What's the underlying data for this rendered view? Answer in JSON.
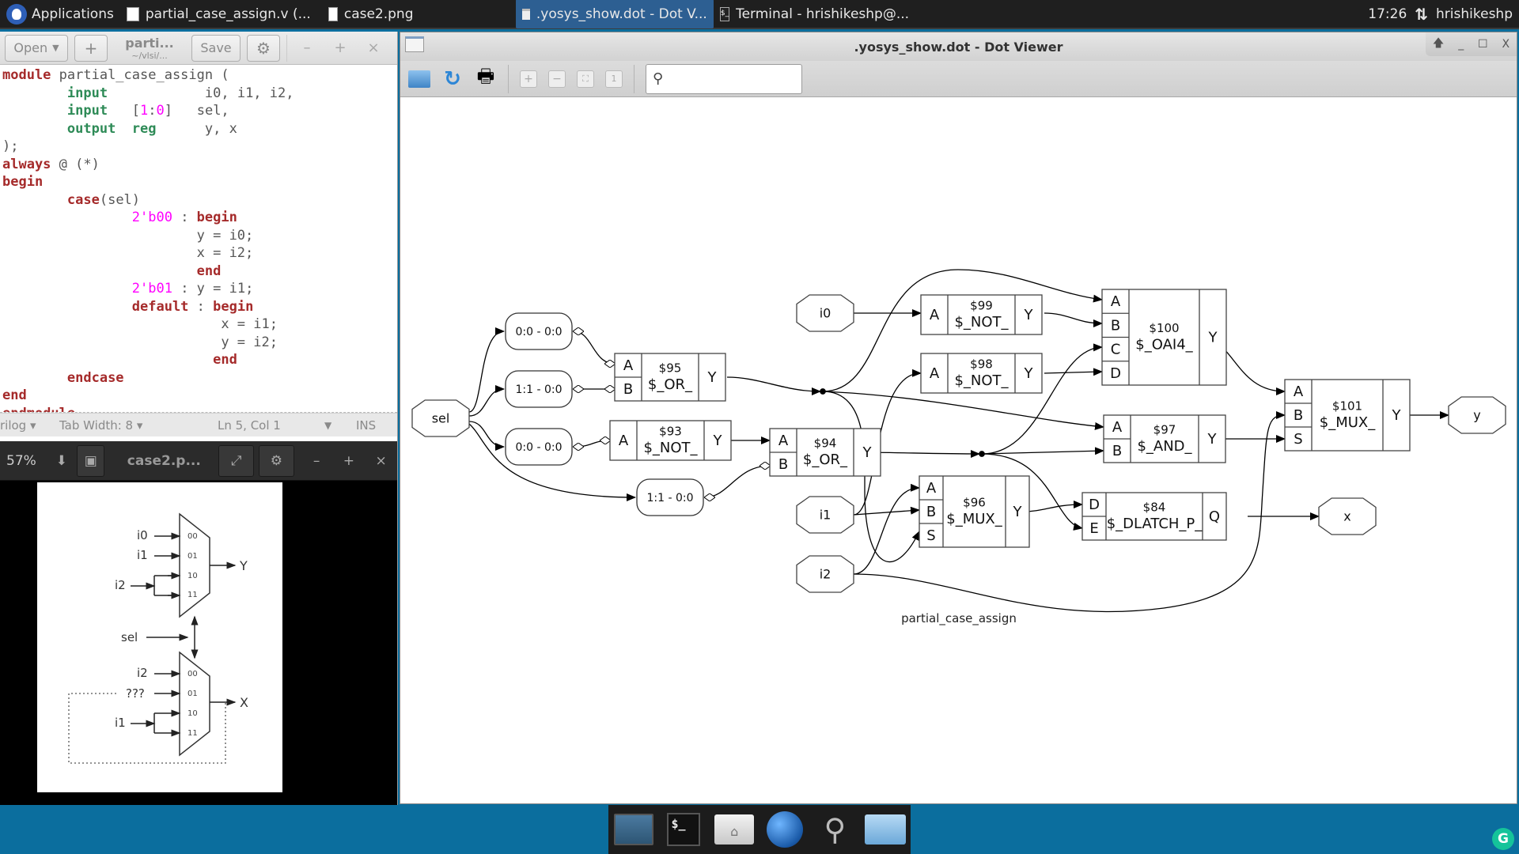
{
  "top_panel": {
    "applications_label": "Applications",
    "tasks": [
      {
        "label": "partial_case_assign.v (...",
        "icon": "text-editor-icon",
        "active": false
      },
      {
        "label": "case2.png",
        "icon": "image-file-icon",
        "active": false
      },
      {
        "label": ".yosys_show.dot - Dot V...",
        "icon": "window-icon",
        "active": true
      },
      {
        "label": "Terminal - hrishikeshp@...",
        "icon": "terminal-icon",
        "active": false
      }
    ],
    "clock": "17:26",
    "network_icon": "network-updown-icon",
    "user": "hrishikeshp"
  },
  "editor": {
    "open_label": "Open",
    "new_tab_label": "+",
    "file_title": "parti...",
    "file_path": "~/vlsi/...",
    "save_label": "Save",
    "code_lines": [
      [
        [
          "kw",
          "module"
        ],
        [
          "p",
          " partial_case_assign ("
        ]
      ],
      [
        [
          "p",
          "        "
        ],
        [
          "ty",
          "input"
        ],
        [
          "p",
          "            i0, i1, i2,"
        ]
      ],
      [
        [
          "p",
          "        "
        ],
        [
          "ty",
          "input"
        ],
        [
          "p",
          "   ["
        ],
        [
          "num",
          "1"
        ],
        [
          "p",
          ":"
        ],
        [
          "num",
          "0"
        ],
        [
          "p",
          "]   sel,"
        ]
      ],
      [
        [
          "p",
          "        "
        ],
        [
          "ty",
          "output"
        ],
        [
          "p",
          "  "
        ],
        [
          "ty",
          "reg"
        ],
        [
          "p",
          "      y, x"
        ]
      ],
      [
        [
          "p",
          ");"
        ]
      ],
      [
        [
          "kw",
          "always"
        ],
        [
          "p",
          " @ (*)"
        ]
      ],
      [
        [
          "kw",
          "begin"
        ]
      ],
      [
        [
          "p",
          "        "
        ],
        [
          "kw",
          "case"
        ],
        [
          "p",
          "(sel)"
        ]
      ],
      [
        [
          "p",
          "                "
        ],
        [
          "num",
          "2'b00"
        ],
        [
          "p",
          " : "
        ],
        [
          "kw",
          "begin"
        ]
      ],
      [
        [
          "p",
          "                        y = i0;"
        ]
      ],
      [
        [
          "p",
          "                        x = i2;"
        ]
      ],
      [
        [
          "p",
          "                        "
        ],
        [
          "kw",
          "end"
        ]
      ],
      [
        [
          "p",
          "                "
        ],
        [
          "num",
          "2'b01"
        ],
        [
          "p",
          " : y = i1;"
        ]
      ],
      [
        [
          "p",
          "                "
        ],
        [
          "kw",
          "default"
        ],
        [
          "p",
          " : "
        ],
        [
          "kw",
          "begin"
        ]
      ],
      [
        [
          "p",
          "                           x = i1;"
        ]
      ],
      [
        [
          "p",
          "                           y = i2;"
        ]
      ],
      [
        [
          "p",
          "                          "
        ],
        [
          "kw",
          "end"
        ]
      ],
      [
        [
          "p",
          "        "
        ],
        [
          "kw",
          "endcase"
        ]
      ],
      [
        [
          "kw",
          "end"
        ]
      ],
      [
        [
          "kw",
          "endmodule"
        ]
      ]
    ],
    "status": {
      "language": "rilog",
      "tab_width": "Tab Width: 8",
      "position": "Ln 5, Col 1",
      "mode": "INS"
    }
  },
  "image_viewer": {
    "zoom": "57%",
    "title": "case2.p...",
    "diagram": {
      "mux_top": {
        "inputs": [
          {
            "label": "i0",
            "sel": "00"
          },
          {
            "label": "i1",
            "sel": "01"
          },
          {
            "label": "i2",
            "sel": "10"
          },
          {
            "label": "",
            "sel": "11"
          }
        ],
        "output": "Y"
      },
      "sel_label": "sel",
      "mux_bottom": {
        "inputs": [
          {
            "label": "i2",
            "sel": "00"
          },
          {
            "label": "???",
            "sel": "01"
          },
          {
            "label": "i1",
            "sel": "10"
          },
          {
            "label": "",
            "sel": "11"
          }
        ],
        "output": "X"
      }
    }
  },
  "dot_viewer": {
    "window_title": ".yosys_show.dot - Dot Viewer",
    "search_placeholder": "",
    "graph_label": "partial_case_assign",
    "ports": {
      "sel": "sel",
      "i0": "i0",
      "i1": "i1",
      "i2": "i2",
      "y": "y",
      "x": "x"
    },
    "slices": {
      "s1": "0:0 - 0:0",
      "s2": "1:1 - 0:0",
      "s3": "0:0 - 0:0",
      "s4": "1:1 - 0:0"
    },
    "cells": {
      "c95": {
        "id": "$95",
        "type": "$_OR_",
        "inputs": [
          "A",
          "B"
        ],
        "output": "Y"
      },
      "c93": {
        "id": "$93",
        "type": "$_NOT_",
        "inputs": [
          "A"
        ],
        "output": "Y"
      },
      "c94": {
        "id": "$94",
        "type": "$_OR_",
        "inputs": [
          "A",
          "B"
        ],
        "output": "Y"
      },
      "c99": {
        "id": "$99",
        "type": "$_NOT_",
        "inputs": [
          "A"
        ],
        "output": "Y"
      },
      "c98": {
        "id": "$98",
        "type": "$_NOT_",
        "inputs": [
          "A"
        ],
        "output": "Y"
      },
      "c96": {
        "id": "$96",
        "type": "$_MUX_",
        "inputs": [
          "A",
          "B",
          "S"
        ],
        "output": "Y"
      },
      "c100": {
        "id": "$100",
        "type": "$_OAI4_",
        "inputs": [
          "A",
          "B",
          "C",
          "D"
        ],
        "output": "Y"
      },
      "c97": {
        "id": "$97",
        "type": "$_AND_",
        "inputs": [
          "A",
          "B"
        ],
        "output": "Y"
      },
      "c84": {
        "id": "$84",
        "type": "$_DLATCH_P_",
        "inputs": [
          "D",
          "E"
        ],
        "output": "Q"
      },
      "c101": {
        "id": "$101",
        "type": "$_MUX_",
        "inputs": [
          "A",
          "B",
          "S"
        ],
        "output": "Y"
      }
    }
  },
  "dock": {
    "items": [
      "show-desktop-icon",
      "terminal-icon",
      "home-folder-icon",
      "web-browser-icon",
      "search-icon",
      "folder-icon"
    ]
  }
}
